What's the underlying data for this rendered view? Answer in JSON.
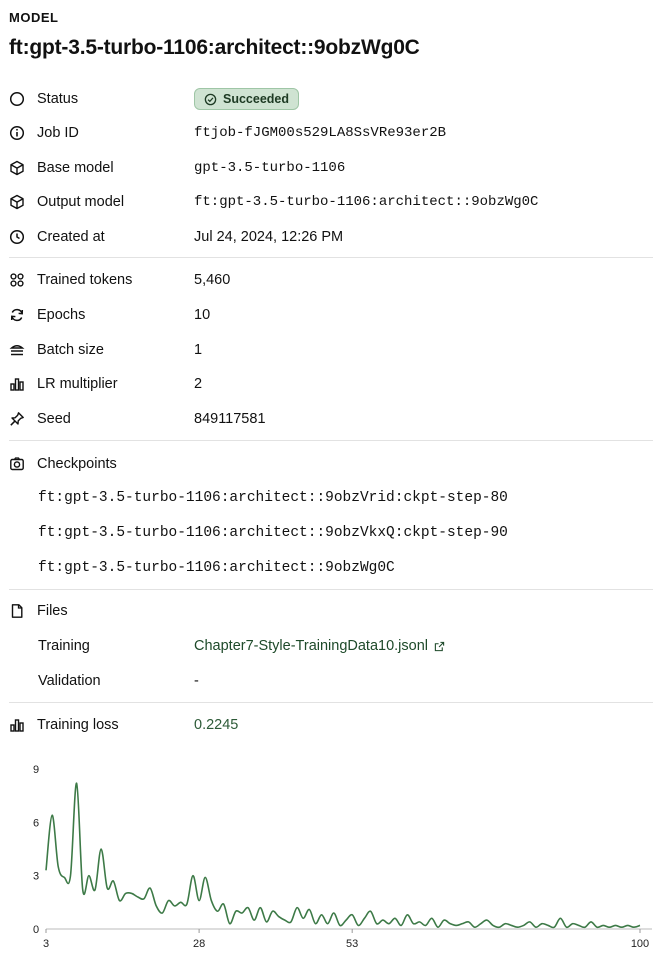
{
  "header": {
    "eyebrow": "MODEL",
    "title": "ft:gpt-3.5-turbo-1106:architect::9obzWg0C"
  },
  "details": {
    "status_label": "Status",
    "status_value": "Succeeded",
    "job_id_label": "Job ID",
    "job_id_value": "ftjob-fJGM00s529LA8SsVRe93er2B",
    "base_model_label": "Base model",
    "base_model_value": "gpt-3.5-turbo-1106",
    "output_model_label": "Output model",
    "output_model_value": "ft:gpt-3.5-turbo-1106:architect::9obzWg0C",
    "created_label": "Created at",
    "created_value": "Jul 24, 2024, 12:26 PM"
  },
  "hyperparams": {
    "trained_tokens_label": "Trained tokens",
    "trained_tokens_value": "5,460",
    "epochs_label": "Epochs",
    "epochs_value": "10",
    "batch_size_label": "Batch size",
    "batch_size_value": "1",
    "lr_label": "LR multiplier",
    "lr_value": "2",
    "seed_label": "Seed",
    "seed_value": "849117581"
  },
  "checkpoints": {
    "label": "Checkpoints",
    "items": [
      "ft:gpt-3.5-turbo-1106:architect::9obzVrid:ckpt-step-80",
      "ft:gpt-3.5-turbo-1106:architect::9obzVkxQ:ckpt-step-90",
      "ft:gpt-3.5-turbo-1106:architect::9obzWg0C"
    ]
  },
  "files": {
    "label": "Files",
    "training_label": "Training",
    "training_value": "Chapter7-Style-TrainingData10.jsonl",
    "validation_label": "Validation",
    "validation_value": "-"
  },
  "loss": {
    "label": "Training loss",
    "value": "0.2245"
  },
  "colors": {
    "accent": "#3d7a47",
    "badge_bg": "#cfe3d2"
  },
  "chart_data": {
    "type": "line",
    "ylim": [
      0,
      9
    ],
    "y_ticks": [
      "0",
      "3",
      "6",
      "9"
    ],
    "x_ticks": [
      3,
      28,
      53,
      100
    ],
    "x_range": [
      3,
      100
    ],
    "series": [
      {
        "x": [
          3,
          4,
          5,
          6,
          7,
          8,
          9,
          10,
          11,
          12,
          13,
          14,
          15,
          16,
          17,
          18,
          19,
          20,
          21,
          22,
          23,
          24,
          25,
          26,
          27,
          28,
          29,
          30,
          31,
          32,
          33,
          34,
          35,
          36,
          37,
          38,
          39,
          40,
          41,
          42,
          43,
          44,
          45,
          46,
          47,
          48,
          49,
          50,
          51,
          52,
          53,
          54,
          55,
          56,
          57,
          58,
          59,
          60,
          61,
          62,
          63,
          64,
          65,
          66,
          67,
          68,
          69,
          70,
          71,
          72,
          73,
          74,
          75,
          76,
          77,
          78,
          79,
          80,
          81,
          82,
          83,
          84,
          85,
          86,
          87,
          88,
          89,
          90,
          91,
          92,
          93,
          94,
          95,
          96,
          97,
          98,
          99,
          100
        ],
        "values": [
          3.3,
          6.4,
          3.5,
          2.9,
          3.0,
          8.2,
          2.2,
          3.0,
          2.2,
          4.5,
          2.3,
          2.7,
          1.6,
          2.0,
          2.0,
          1.8,
          1.7,
          2.3,
          1.3,
          0.9,
          1.6,
          1.3,
          1.5,
          1.4,
          3.0,
          1.6,
          2.9,
          1.6,
          1.0,
          1.4,
          0.3,
          1.0,
          0.9,
          1.2,
          0.5,
          1.2,
          0.4,
          1.0,
          0.7,
          0.5,
          0.4,
          1.2,
          0.6,
          1.1,
          0.3,
          0.8,
          0.3,
          0.9,
          0.2,
          0.5,
          0.8,
          0.2,
          0.6,
          1.0,
          0.3,
          0.5,
          0.3,
          0.6,
          0.2,
          0.8,
          0.3,
          0.4,
          0.2,
          0.6,
          0.1,
          0.5,
          0.3,
          0.2,
          0.3,
          0.4,
          0.1,
          0.3,
          0.5,
          0.2,
          0.1,
          0.3,
          0.2,
          0.1,
          0.2,
          0.4,
          0.1,
          0.3,
          0.2,
          0.1,
          0.6,
          0.1,
          0.3,
          0.2,
          0.1,
          0.4,
          0.1,
          0.2,
          0.1,
          0.2,
          0.1,
          0.2,
          0.1,
          0.2
        ]
      }
    ]
  }
}
